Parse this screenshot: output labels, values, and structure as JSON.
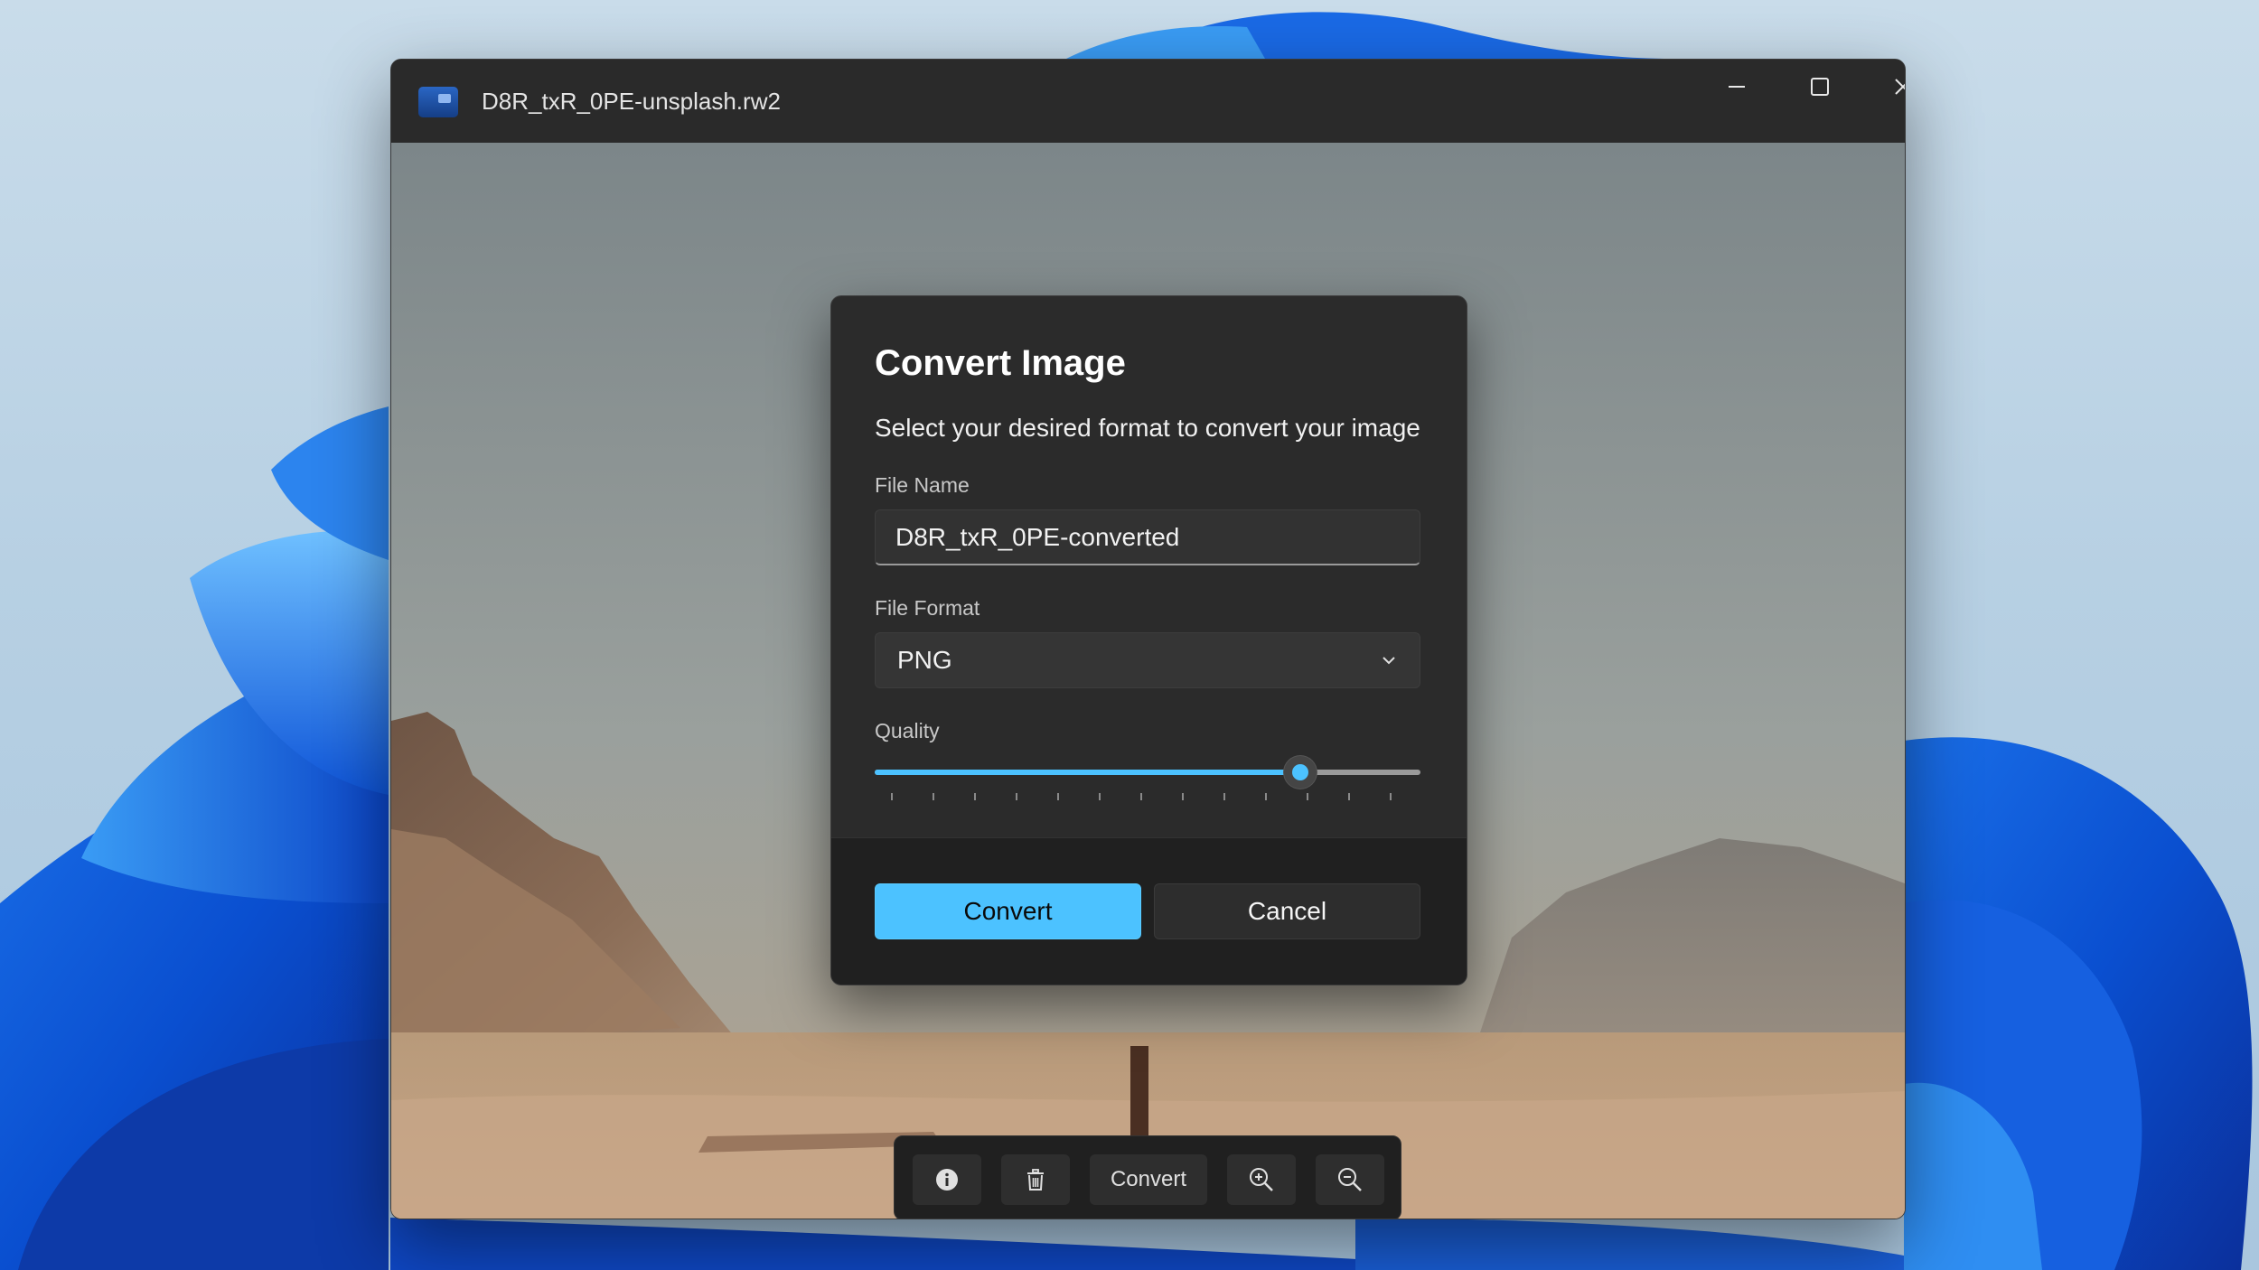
{
  "window": {
    "title": "D8R_txR_0PE-unsplash.rw2",
    "minimize_icon": "minimize-icon",
    "maximize_icon": "maximize-icon",
    "close_icon": "close-icon"
  },
  "dialog": {
    "title": "Convert Image",
    "subtitle": "Select your desired format to convert your image",
    "file_name_label": "File Name",
    "file_name_value": "D8R_txR_0PE-converted",
    "file_format_label": "File Format",
    "file_format_value": "PNG",
    "quality_label": "Quality",
    "quality_fraction": 0.78,
    "convert_label": "Convert",
    "cancel_label": "Cancel"
  },
  "toolbar": {
    "info_icon": "info-icon",
    "delete_icon": "trash-icon",
    "convert_label": "Convert",
    "zoom_in_icon": "zoom-in-icon",
    "zoom_out_icon": "zoom-out-icon"
  },
  "colors": {
    "accent": "#4cc2ff",
    "dialog_bg": "#2b2b2b",
    "footer_bg": "#202020"
  }
}
